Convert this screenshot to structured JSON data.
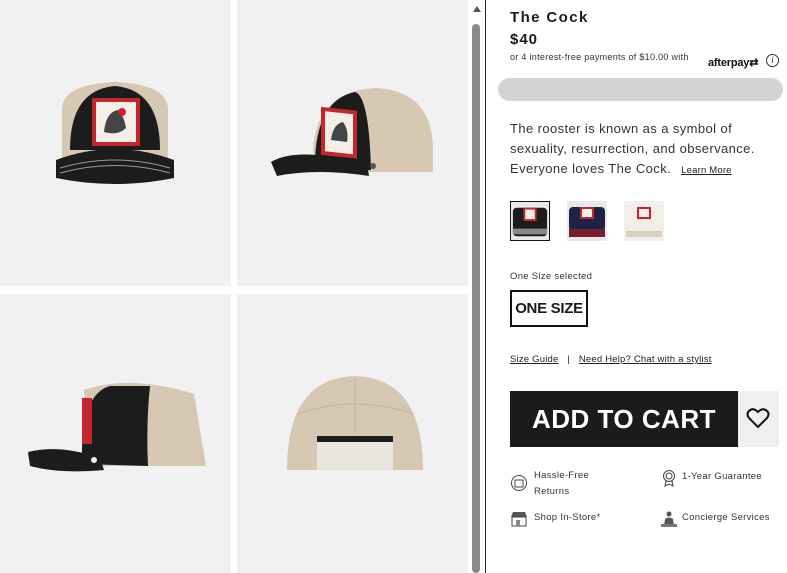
{
  "product": {
    "title": "The Cock",
    "price": "$40",
    "afterpay_text": "or 4 interest-free payments of $10.00 with",
    "afterpay_logo": "afterpay",
    "info_symbol": "i",
    "description": "The rooster is known as a symbol of sexuality, resurrection, and observance. Everyone loves The Cock.",
    "learn_more": "Learn More"
  },
  "swatches": [
    {
      "name": "black",
      "selected": true,
      "color": "#1c1c1c"
    },
    {
      "name": "navy-red",
      "selected": false,
      "color": "#7a1d2e"
    },
    {
      "name": "white",
      "selected": false,
      "color": "#e8e2d6"
    }
  ],
  "size": {
    "selected_text": "One Size selected",
    "option": "ONE SIZE"
  },
  "links": {
    "size_guide": "Size Guide",
    "separator": "|",
    "chat": "Need Help? Chat with a stylist"
  },
  "cart": {
    "add_to_cart": "ADD TO CART"
  },
  "features": [
    {
      "icon": "returns-icon",
      "label": "Hassle-Free Returns"
    },
    {
      "icon": "guarantee-badge-icon",
      "label": "1-Year Guarantee"
    },
    {
      "icon": "store-icon",
      "label": "Shop In-Store*"
    },
    {
      "icon": "concierge-icon",
      "label": "Concierge Services"
    }
  ],
  "colors": {
    "cap_black": "#1c1c1c",
    "mesh": "#d7c8b3",
    "patch_red": "#c4262e",
    "button_dark": "#1b1b1b",
    "grey_bar": "#d4d4d4"
  }
}
